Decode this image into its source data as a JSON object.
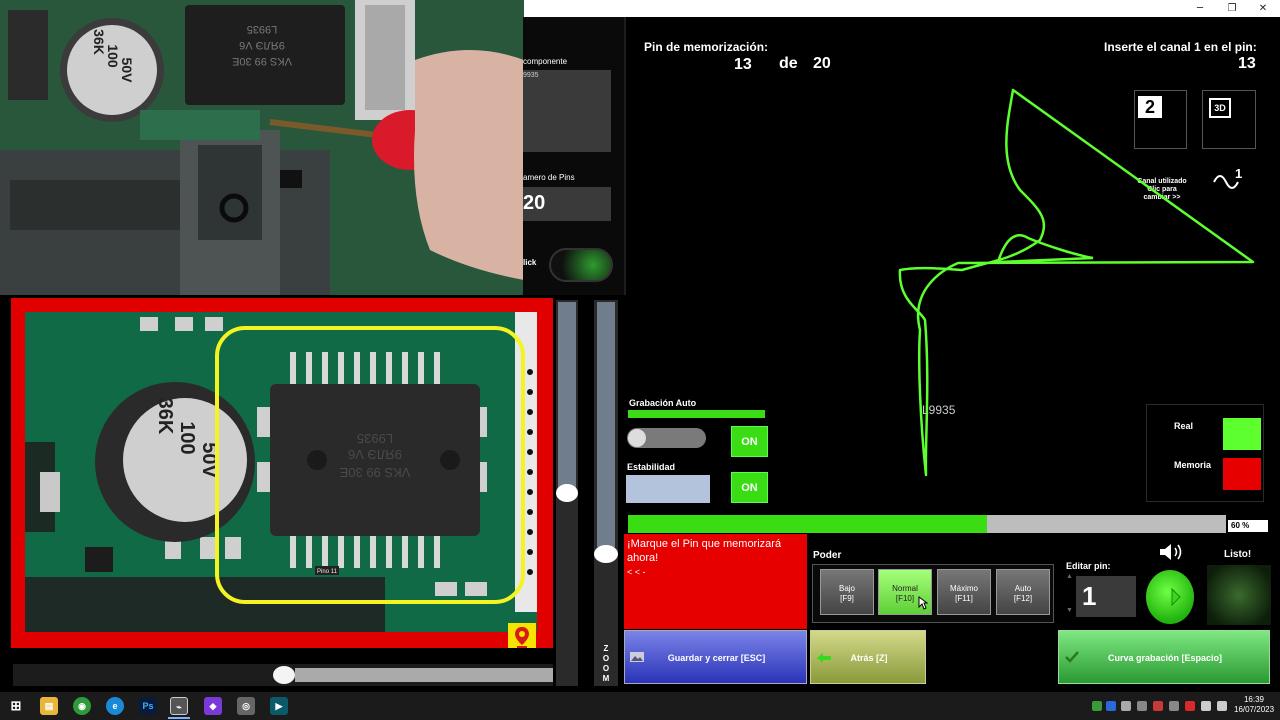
{
  "window": {
    "minimize": "─",
    "maximize": "❐",
    "close": "✕"
  },
  "left_panel": {
    "component_label": "componente",
    "component_value": "9935",
    "pins_label": "amero de Pins",
    "pins_value": "20",
    "click_label": "lick"
  },
  "header": {
    "pin_memo_label": "Pin de memorización:",
    "pin_current": "13",
    "de_label": "de",
    "pin_total": "20",
    "insert_label": "Inserte el canal 1 en el pin:",
    "insert_pin": "13"
  },
  "view_buttons": {
    "two_d": "2",
    "three_d": "3D"
  },
  "channel": {
    "line1": "Canal utilizado",
    "line2": "Clic para",
    "line3": "cambiar >>",
    "number": "1"
  },
  "curve": {
    "label": "L9935",
    "color": "#5eff2e"
  },
  "legend": {
    "real_label": "Real",
    "real_color": "#5eff2e",
    "memoria_label": "Memoria",
    "memoria_color": "#e60000"
  },
  "grabacion": {
    "label": "Grabación Auto",
    "toggle": "ON"
  },
  "estabilidad": {
    "label": "Estabilidad",
    "toggle": "ON"
  },
  "progress": {
    "percent_text": "60 %",
    "value": 0.6
  },
  "message": {
    "line1": "¡Marque el Pin que memorizará",
    "line2": "ahora!",
    "line3": "< < -"
  },
  "poder": {
    "label": "Poder",
    "buttons": [
      {
        "name": "Bajo",
        "key": "[F9]"
      },
      {
        "name": "Normal",
        "key": "[F10]"
      },
      {
        "name": "Máximo",
        "key": "[F11]"
      },
      {
        "name": "Auto",
        "key": "[F12]"
      }
    ],
    "selected": "Normal"
  },
  "edit_pin": {
    "label": "Editar pin:",
    "value": "1"
  },
  "listo": {
    "label": "Listo!"
  },
  "actions": {
    "save": "Guardar y cerrar [ESC]",
    "back": "Atrás [Z]",
    "curve": "Curva grabación [Espacio]"
  },
  "microscope": {
    "pin_tag": "Pino 11",
    "chip_text1": "VKS 99 30E",
    "chip_text2": "9ЯЛЭ V6",
    "chip_text3": "L9935",
    "cap_text1": "50V",
    "cap_text2": "100",
    "cap_text3": "36K"
  },
  "zoom": {
    "letters": [
      "Z",
      "O",
      "O",
      "M"
    ]
  },
  "camera": {
    "cap_text1": "50V",
    "cap_text2": "100",
    "cap_text3": "36K",
    "chip_text1": "VKS 99 30E",
    "chip_text2": "9ЯЛЭ V6",
    "chip_text3": "L9935"
  },
  "taskbar": {
    "apps": [
      "⊞",
      "▤",
      "◉",
      "e",
      "Ps",
      "⌁",
      "◆",
      "◎",
      "▶"
    ],
    "time": "16:39",
    "date": "16/07/2023"
  }
}
